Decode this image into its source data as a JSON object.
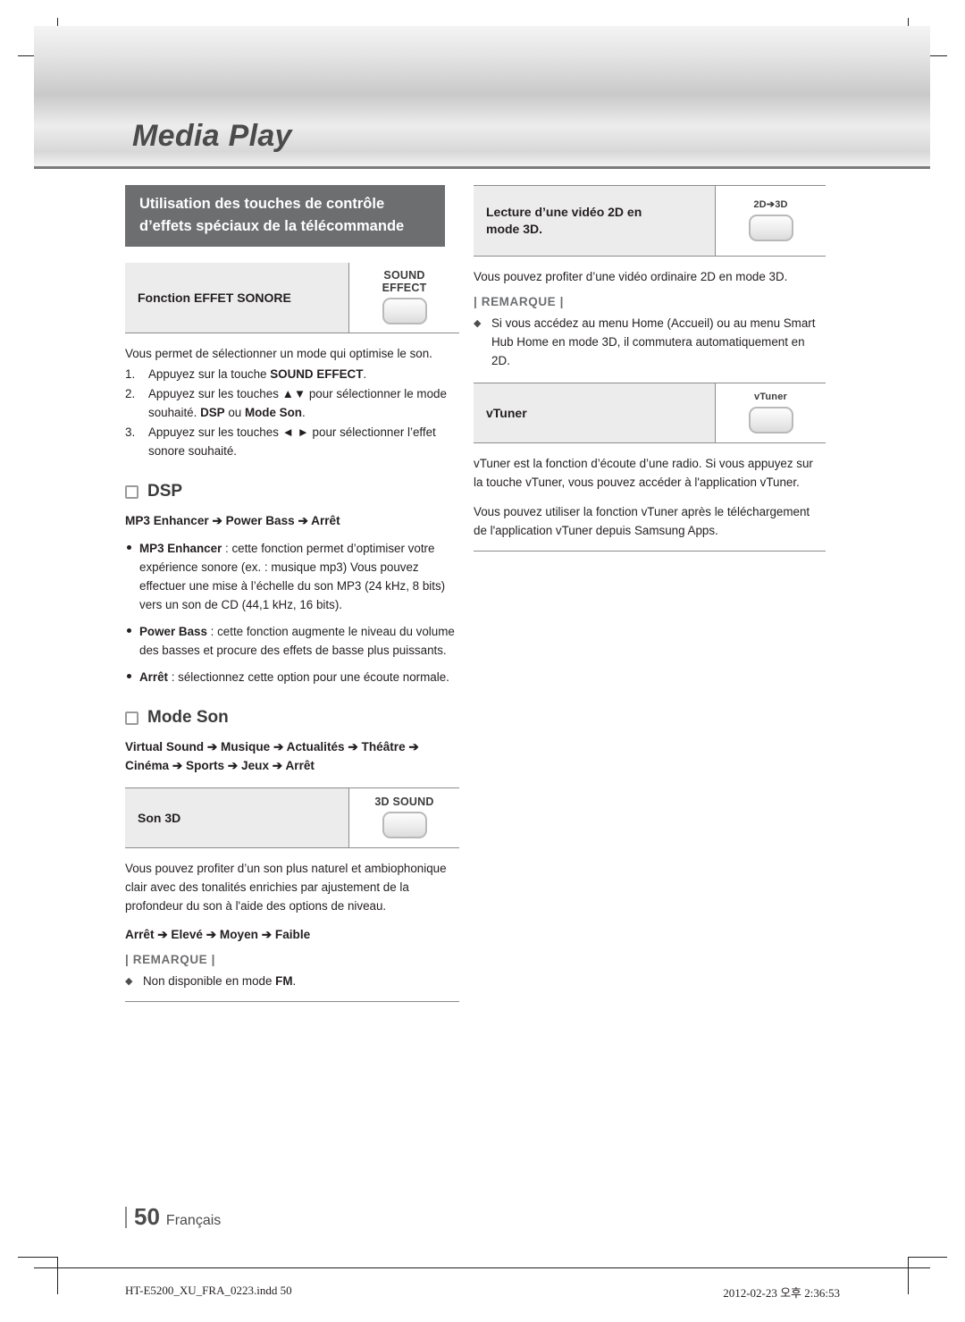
{
  "header": {
    "chapter": "Media Play"
  },
  "left": {
    "section_title_line1": "Utilisation des touches de contrôle",
    "section_title_line2": "d’effets spéciaux de la télécommande",
    "sound_effect": {
      "label": "Fonction EFFET SONORE",
      "key_line1": "SOUND",
      "key_line2": "EFFECT"
    },
    "intro": "Vous permet de sélectionner un mode qui optimise le son.",
    "steps": [
      {
        "n": "1.",
        "pre": "Appuyez sur la touche ",
        "bold": "SOUND EFFECT",
        "post": "."
      },
      {
        "n": "2.",
        "pre": "Appuyez sur les touches ▲▼ pour sélectionner le mode souhaité. ",
        "bold": "DSP",
        "mid": " ou ",
        "bold2": "Mode Son",
        "post": "."
      },
      {
        "n": "3.",
        "pre": "Appuyez sur les touches ◄ ► pour sélectionner l’effet sonore souhaité.",
        "bold": "",
        "post": ""
      }
    ],
    "dsp": {
      "heading": "DSP",
      "chain": "MP3 Enhancer ➔ Power Bass ➔ Arrêt",
      "bullets": [
        {
          "bold": "MP3 Enhancer",
          "text": " : cette fonction permet d’optimiser votre expérience sonore (ex. : musique mp3) Vous pouvez effectuer une mise à l’échelle du son MP3 (24 kHz, 8 bits) vers un son de CD (44,1 kHz, 16 bits)."
        },
        {
          "bold": "Power Bass",
          "text": " : cette fonction augmente le niveau du volume des basses et procure des effets de basse plus puissants."
        },
        {
          "bold": "Arrêt",
          "text": " : sélectionnez cette option pour une écoute normale."
        }
      ]
    },
    "mode_son": {
      "heading": "Mode Son",
      "chain_line1": "Virtual Sound ➔ Musique ➔ Actualités ➔ Théâtre ➔",
      "chain_line2": "Cinéma ➔ Sports ➔ Jeux ➔ Arrêt",
      "row_label": "Son 3D",
      "key_text": "3D SOUND",
      "body": "Vous pouvez profiter d’un son plus naturel et ambiophonique clair avec des tonalités enrichies par ajustement de la profondeur du son à l'aide des options de niveau.",
      "chain_levels": "Arrêt ➔ Elevé ➔ Moyen ➔ Faible",
      "remark_title": "| REMARQUE |",
      "remark_pre": "Non disponible en mode ",
      "remark_bold": "FM",
      "remark_post": "."
    }
  },
  "right": {
    "video2d3d": {
      "label_line1": "Lecture d’une vidéo 2D en",
      "label_line2": "mode 3D.",
      "key_text": "2D➔3D"
    },
    "video2d3d_body": "Vous pouvez profiter d’une vidéo ordinaire 2D en mode 3D.",
    "remark_title": "| REMARQUE |",
    "remark_item": "Si vous accédez au menu Home (Accueil) ou au menu Smart Hub Home en mode 3D, il commutera automatiquement en 2D.",
    "vtuner": {
      "label": "vTuner",
      "key_text": "vTuner"
    },
    "vtuner_body1": "vTuner est la fonction d’écoute d’une radio. Si vous appuyez sur la touche vTuner, vous pouvez accéder à l'application vTuner.",
    "vtuner_body2": "Vous pouvez utiliser la fonction vTuner après le téléchargement de l'application vTuner depuis Samsung Apps."
  },
  "footer": {
    "page_number": "50",
    "language": "Français",
    "file_name": "HT-E5200_XU_FRA_0223.indd   50",
    "timestamp": "2012-02-23   오후 2:36:53"
  }
}
